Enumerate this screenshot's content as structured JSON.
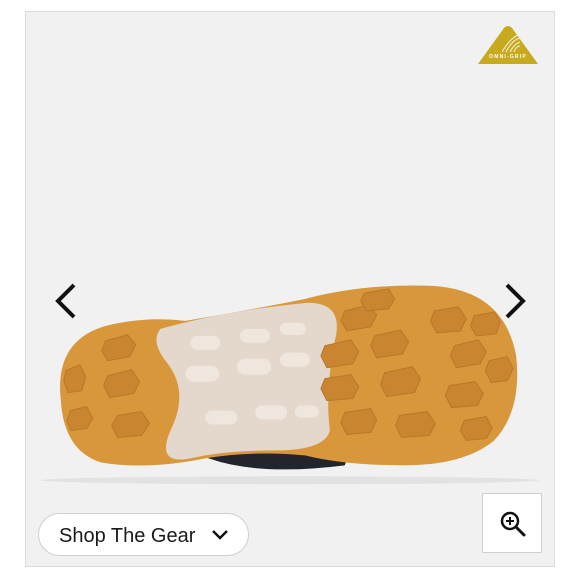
{
  "gallery": {
    "badge": {
      "text": "OMNI-GRIP",
      "color": "#c8aa1e",
      "icon": "omni-grip-badge-icon"
    },
    "prev_icon": "chevron-left-icon",
    "next_icon": "chevron-right-icon",
    "zoom_icon": "zoom-in-icon",
    "sole_colors": {
      "lug": "#d9973c",
      "midsole": "#e4d8cc",
      "upper": "#23252d"
    }
  },
  "actions": {
    "shop_label": "Shop The Gear",
    "shop_icon": "chevron-down-icon"
  }
}
